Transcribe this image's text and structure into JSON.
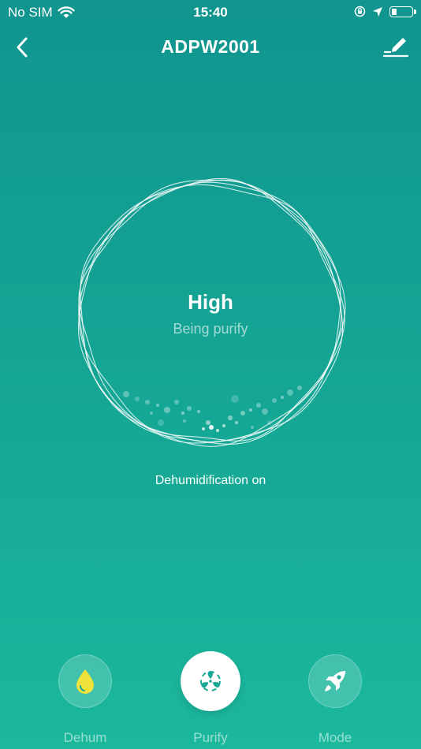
{
  "status_bar": {
    "carrier": "No SIM",
    "time": "15:40",
    "battery_level": 0.25
  },
  "header": {
    "title": "ADPW2001",
    "back_icon": "chevron-left-icon",
    "edit_icon": "edit-pencil-icon"
  },
  "main": {
    "mode_level": "High",
    "mode_status": "Being purify",
    "dehum_status": "Dehumidification on"
  },
  "controls": [
    {
      "label": "Dehum",
      "icon": "water-drop-icon",
      "active": false
    },
    {
      "label": "Purify",
      "icon": "fan-icon",
      "active": true
    },
    {
      "label": "Mode",
      "icon": "rocket-icon",
      "active": false
    }
  ],
  "colors": {
    "background_top": "#10958f",
    "background_bottom": "#1bb89c",
    "drop_yellow": "#f1e33b",
    "icon_active": "#1aa995"
  }
}
